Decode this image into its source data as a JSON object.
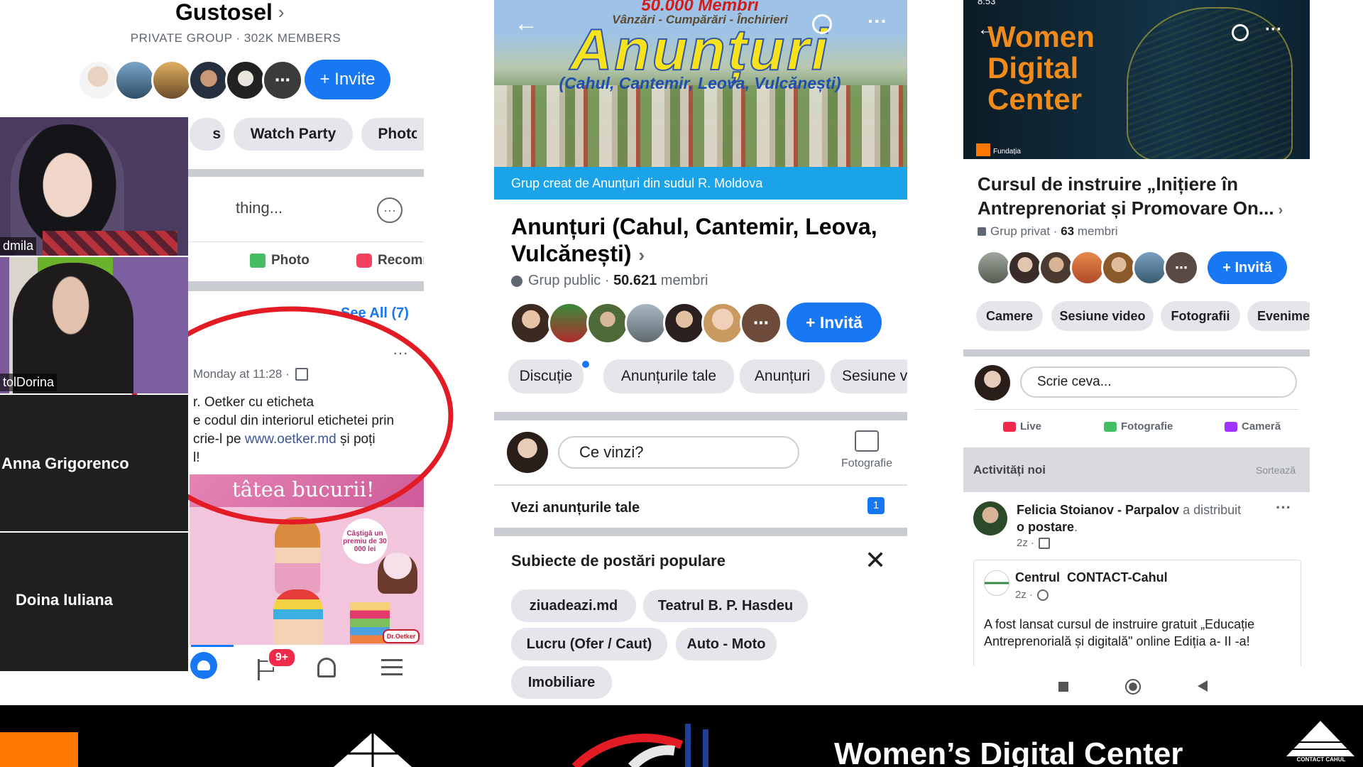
{
  "phone1": {
    "group_name": "Gustosel",
    "group_meta": "PRIVATE GROUP · 302K MEMBERS",
    "invite_label": "+ Invite",
    "tabs": [
      "s",
      "Watch Party",
      "Photos"
    ],
    "composer_placeholder": "thing...",
    "photo_label": "Photo",
    "recommend_label": "Recommend",
    "see_all_label": "See All (7)",
    "post_time": "Monday at 11:28 ·",
    "post_text_1": "r. Oetker cu eticheta",
    "post_text_2": "e codul din interiorul etichetei prin",
    "post_text_3a": "crie-l pe ",
    "post_link": "www.oetker.md",
    "post_text_3b": " și poți",
    "post_text_4": "l!",
    "banner_text": "tâtea bucurii!",
    "promo_text": "Câștigă un premiu de 30 000 lei",
    "brand_badge": "Dr.Oetker",
    "notif_badge": "9+"
  },
  "video_tiles": [
    {
      "name": "dmila",
      "type": "video"
    },
    {
      "name": "tolDorina",
      "type": "video"
    },
    {
      "name": "Anna Grigorenco",
      "type": "name"
    },
    {
      "name": "Doina Iuliana",
      "type": "name"
    }
  ],
  "phone2": {
    "cover_members": "50.000 Membri",
    "cover_tagline": "Vânzări - Cumpărări - Închirieri",
    "cover_title": "Anunțuri",
    "cover_subtitle": "(Cahul, Cantemir, Leova, Vulcănești)",
    "cover_bar": "Grup creat de Anunțuri din sudul R. Moldova",
    "group_title_1": "Anunțuri (Cahul, Cantemir, Leova,",
    "group_title_2": "Vulcănești)",
    "group_meta_prefix": "Grup public · ",
    "group_members_count": "50.621",
    "group_members_suffix": " membri",
    "invite_label": "+ Invită",
    "tabs": [
      "Discuție",
      "Anunțurile tale",
      "Anunțuri",
      "Sesiune v"
    ],
    "composer_placeholder": "Ce vinzi?",
    "photo_label": "Fotografie",
    "see_ads_label": "Vezi anunțurile tale",
    "see_ads_count": "1",
    "topics_title": "Subiecte de postări populare",
    "topics": [
      "ziuadeazi.md",
      "Teatrul B. P. Hasdeu",
      "Lucru (Ofer / Caut)",
      "Auto - Moto",
      "Imobiliare"
    ]
  },
  "phone3": {
    "status_time": "8:53",
    "cover_title_1": "Women",
    "cover_title_2": "Digital",
    "cover_title_3": "Center",
    "cover_footer": "Fundația",
    "group_title_1": "Cursul de instruire „Inițiere în",
    "group_title_2": "Antreprenoriat și Promovare On...",
    "group_meta_prefix": "Grup privat · ",
    "group_members_count": "63",
    "group_members_suffix": " membri",
    "invite_label": "+ Invită",
    "tabs": [
      "Camere",
      "Sesiune video",
      "Fotografii",
      "Evenimen"
    ],
    "composer_placeholder": "Scrie ceva...",
    "live_label": "Live",
    "photo_label": "Fotografie",
    "camera_label": "Cameră",
    "activity_label": "Activități noi",
    "sort_label": "Sortează",
    "sharer_name": "Felicia Stoianov - Parpalov",
    "shared_text": " a distribuit",
    "shared_object": "o postare",
    "share_time": "2z ·",
    "org_name": "Centrul  CONTACT-Cahul",
    "org_time": "2z ·",
    "post_body_1": "A fost lansat cursul de instruire gratuit „Educație",
    "post_body_2": "Antreprenorială și digitală\" online Ediția a- II -a!"
  },
  "footer": {
    "title": "Women’s Digital Center",
    "contact_logo": "CONTACT CAHUL"
  }
}
